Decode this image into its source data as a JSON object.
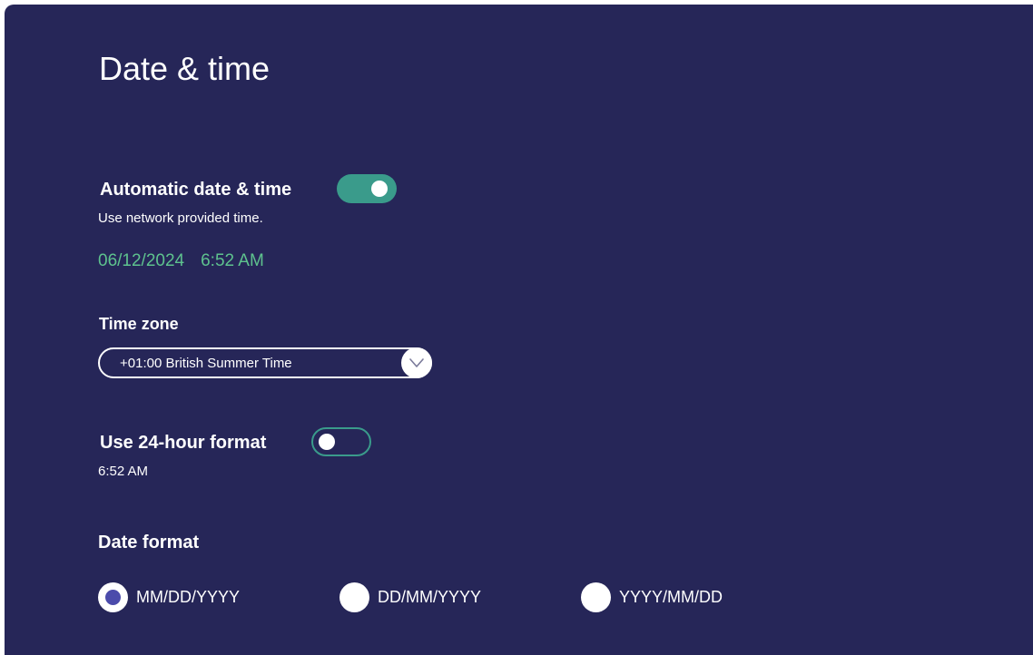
{
  "page": {
    "title": "Date & time"
  },
  "automatic": {
    "label": "Automatic date & time",
    "description": "Use network provided time.",
    "enabled": true,
    "current_date": "06/12/2024",
    "current_time": "6:52 AM"
  },
  "timezone": {
    "label": "Time zone",
    "selected": "+01:00 British Summer Time",
    "icon": "chevron-down-icon"
  },
  "hour24": {
    "label": "Use 24-hour format",
    "enabled": false,
    "example": "6:52 AM"
  },
  "date_format": {
    "label": "Date format",
    "options": [
      {
        "label": "MM/DD/YYYY",
        "selected": true
      },
      {
        "label": "DD/MM/YYYY",
        "selected": false
      },
      {
        "label": "YYYY/MM/DD",
        "selected": false
      }
    ]
  },
  "colors": {
    "background": "#262658",
    "accent": "#3a9b8b",
    "time_text": "#5ec28e",
    "radio_selected": "#4b4bab"
  }
}
